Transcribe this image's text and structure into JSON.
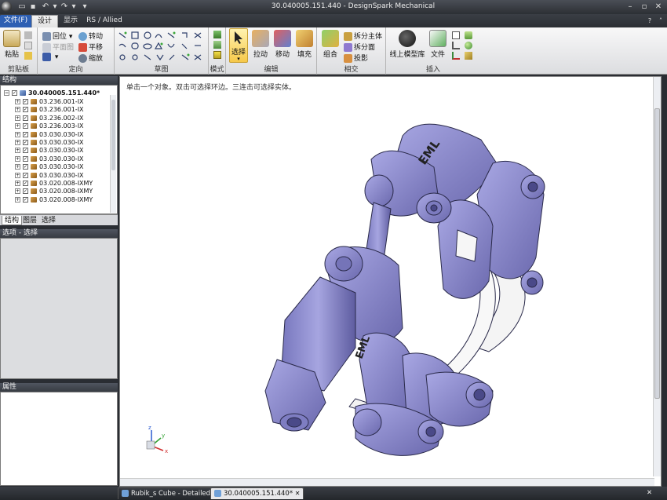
{
  "window": {
    "title": "30.040005.151.440 - DesignSpark Mechanical"
  },
  "menu": {
    "file": "文件(F)",
    "tabs": [
      "设计",
      "显示",
      "RS / Allied"
    ]
  },
  "ribbon": {
    "clipboard": {
      "label": "剪贴板",
      "paste": "粘贴"
    },
    "orient": {
      "label": "定向",
      "home": "回位",
      "plane_view": "平面图",
      "spin": "转动",
      "pan": "平移",
      "zoom": "缩放"
    },
    "sketch": {
      "label": "草图"
    },
    "mode": {
      "label": "模式"
    },
    "edit": {
      "label": "编辑",
      "select": "选择",
      "pull": "拉动",
      "move": "移动",
      "fill": "填充"
    },
    "intersect": {
      "label": "相交",
      "combine": "组合",
      "split_body": "拆分主体",
      "split_face": "拆分面",
      "project": "投影"
    },
    "insert": {
      "label": "插入",
      "online_library": "线上模型库",
      "file": "文件"
    }
  },
  "structure": {
    "title": "结构",
    "root": "30.040005.151.440*",
    "items": [
      "03.236.001-IX",
      "03.236.001-IX",
      "03.236.002-IX",
      "03.236.003-IX",
      "03.030.030-IX",
      "03.030.030-IX",
      "03.030.030-IX",
      "03.030.030-IX",
      "03.030.030-IX",
      "03.030.030-IX",
      "03.020.008-IXMY",
      "03.020.008-IXMY",
      "03.020.008-IXMY"
    ],
    "tabs": [
      "结构",
      "图层",
      "选择"
    ]
  },
  "options": {
    "title": "选项 - 选择"
  },
  "properties": {
    "title": "属性"
  },
  "viewport": {
    "hint": "单击一个对象。双击可选择环边。三连击可选择实体。",
    "part_label_1": "EML",
    "part_label_2": "EML"
  },
  "doc_tabs": [
    "Rubik_s Cube - Detailed*",
    "30.040005.151.440*"
  ],
  "colors": {
    "model": "#8a89c9",
    "accent": "#2d5fb3"
  }
}
